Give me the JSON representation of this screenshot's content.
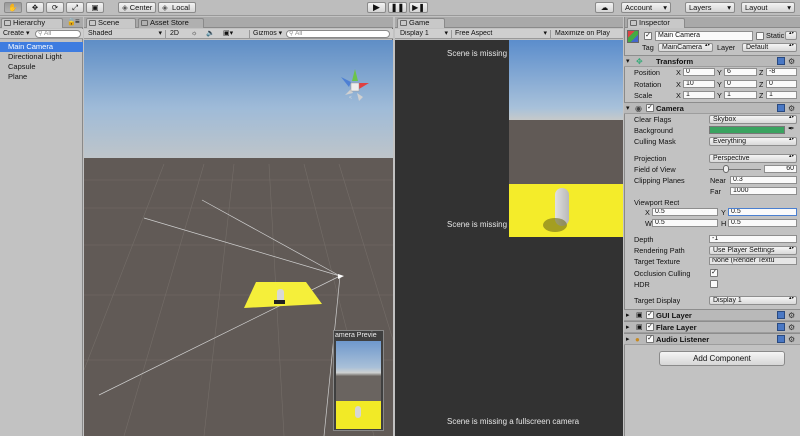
{
  "toolbar": {
    "center_label": "Center",
    "local_label": "Local",
    "account_label": "Account",
    "layers_label": "Layers",
    "layout_label": "Layout"
  },
  "hierarchy": {
    "tab_label": "Hierarchy",
    "create_label": "Create",
    "search_placeholder": "All",
    "items": [
      "Main Camera",
      "Directional Light",
      "Capsule",
      "Plane"
    ]
  },
  "scene": {
    "tab_label": "Scene",
    "asset_store_label": "Asset Store",
    "shading_label": "Shaded",
    "mode_2d_label": "2D",
    "gizmos_label": "Gizmos",
    "search_placeholder": "All",
    "camera_preview_label": "amera Previe"
  },
  "game": {
    "tab_label": "Game",
    "display_label": "Display 1",
    "aspect_label": "Free Aspect",
    "maximize_label": "Maximize on Play",
    "missing_text_1": "Scene is missing",
    "missing_text_2": "Scene is missing",
    "missing_text_3": "Scene is missing a fullscreen camera"
  },
  "inspector": {
    "tab_label": "Inspector",
    "object_name": "Main Camera",
    "static_label": "Static",
    "tag_label": "Tag",
    "tag_value": "MainCamera",
    "layer_label": "Layer",
    "layer_value": "Default",
    "transform": {
      "title": "Transform",
      "position_label": "Position",
      "rotation_label": "Rotation",
      "scale_label": "Scale",
      "x": "X",
      "y": "Y",
      "z": "Z",
      "position": [
        "0",
        "6",
        "-8"
      ],
      "rotation": [
        "10",
        "0",
        "0"
      ],
      "scale": [
        "1",
        "1",
        "1"
      ]
    },
    "camera": {
      "title": "Camera",
      "clear_flags_label": "Clear Flags",
      "clear_flags_value": "Skybox",
      "background_label": "Background",
      "background_color": "#3aa360",
      "culling_mask_label": "Culling Mask",
      "culling_mask_value": "Everything",
      "projection_label": "Projection",
      "projection_value": "Perspective",
      "fov_label": "Field of View",
      "fov_value": "60",
      "fov_slider_fraction": 0.33,
      "clipping_label": "Clipping Planes",
      "near_label": "Near",
      "near_value": "0.3",
      "far_label": "Far",
      "far_value": "1000",
      "viewport_label": "Viewport Rect",
      "vx_label": "X",
      "vx_value": "0.5",
      "vy_label": "Y",
      "vy_value": "0.5",
      "vw_label": "W",
      "vw_value": "0.5",
      "vh_label": "H",
      "vh_value": "0.5",
      "depth_label": "Depth",
      "depth_value": "-1",
      "rendering_path_label": "Rendering Path",
      "rendering_path_value": "Use Player Settings",
      "target_texture_label": "Target Texture",
      "target_texture_value": "None (Render Textu",
      "occlusion_label": "Occlusion Culling",
      "hdr_label": "HDR",
      "target_display_label": "Target Display",
      "target_display_value": "Display 1"
    },
    "gui_layer_title": "GUI Layer",
    "flare_layer_title": "Flare Layer",
    "audio_listener_title": "Audio Listener",
    "add_component_label": "Add Component"
  }
}
